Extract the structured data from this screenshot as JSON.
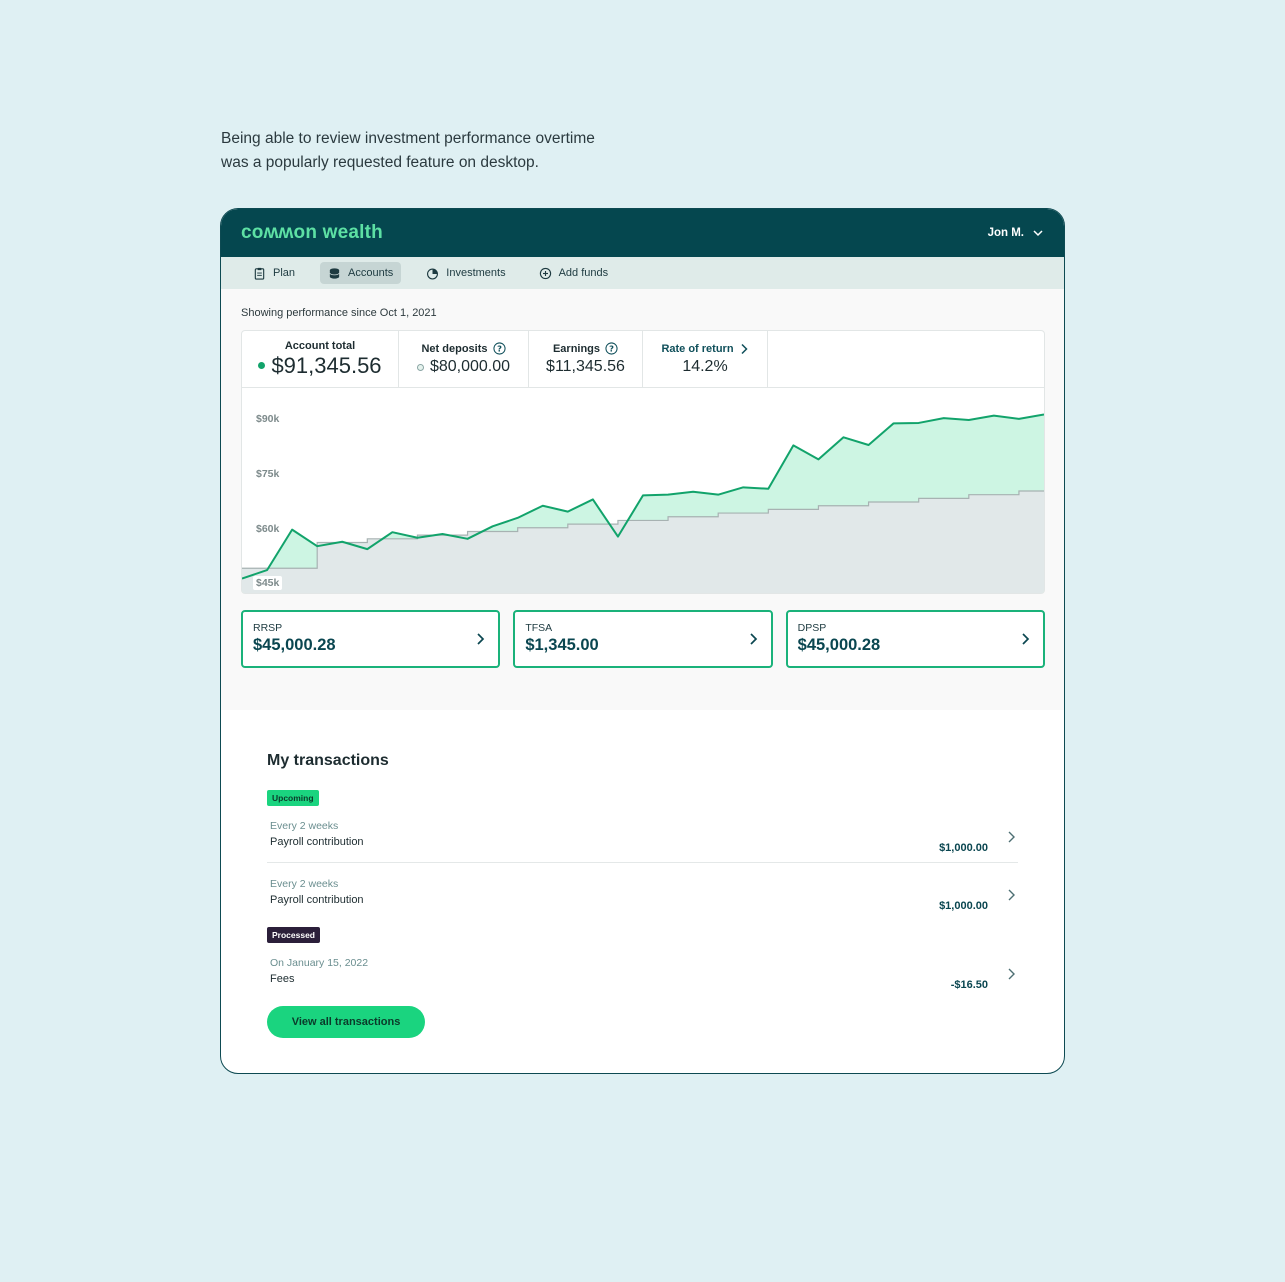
{
  "caption": {
    "line1": "Being able to review investment performance overtime",
    "line2": "was a popularly requested feature on desktop."
  },
  "header": {
    "logo": "coʍʍon wealth",
    "user": "Jon M."
  },
  "nav": [
    {
      "label": "Plan",
      "icon": "clipboard-icon",
      "active": false
    },
    {
      "label": "Accounts",
      "icon": "coins-icon",
      "active": true
    },
    {
      "label": "Investments",
      "icon": "pie-chart-icon",
      "active": false
    },
    {
      "label": "Add funds",
      "icon": "plus-circle-icon",
      "active": false
    }
  ],
  "performance": {
    "since": "Showing performance since Oct 1, 2021",
    "account_total_label": "Account total",
    "account_total": "$91,345.56",
    "net_deposits_label": "Net deposits",
    "net_deposits": "$80,000.00",
    "earnings_label": "Earnings",
    "earnings": "$11,345.56",
    "rate_label": "Rate of return",
    "rate": "14.2%"
  },
  "chart_data": {
    "type": "area",
    "y_ticks": [
      "$90k",
      "$75k",
      "$60k",
      "$45k"
    ],
    "ylim": [
      40000,
      96000
    ],
    "colors": {
      "total": "#12a36b",
      "total_fill": "#cdf5e3",
      "deposits": "#a7b2b2",
      "deposits_fill": "#e1e8e9"
    },
    "series": [
      {
        "name": "Account total",
        "values": [
          44200,
          46500,
          57500,
          53000,
          54200,
          52200,
          56800,
          55300,
          56300,
          55000,
          58400,
          60700,
          64000,
          62400,
          65700,
          55600,
          66800,
          67000,
          67800,
          67000,
          69000,
          68600,
          80400,
          76600,
          82600,
          80500,
          86400,
          86500,
          87800,
          87300,
          88500,
          87600,
          88800
        ]
      },
      {
        "name": "Net deposits",
        "values": [
          47000,
          47000,
          47000,
          54000,
          54000,
          55000,
          55000,
          56000,
          56000,
          57000,
          57000,
          58000,
          58000,
          59000,
          59000,
          60000,
          60000,
          61000,
          61000,
          62000,
          62000,
          63000,
          63000,
          64000,
          64000,
          65000,
          65000,
          66000,
          66000,
          67000,
          67000,
          68000,
          68000
        ]
      }
    ]
  },
  "accounts": [
    {
      "name": "RRSP",
      "value": "$45,000.28"
    },
    {
      "name": "TFSA",
      "value": "$1,345.00"
    },
    {
      "name": "DPSP",
      "value": "$45,000.28"
    }
  ],
  "transactions": {
    "title": "My transactions",
    "upcoming_badge": "Upcoming",
    "processed_badge": "Processed",
    "items": [
      {
        "freq": "Every 2 weeks",
        "desc": "Payroll contribution",
        "amount": "$1,000.00"
      },
      {
        "freq": "Every 2 weeks",
        "desc": "Payroll contribution",
        "amount": "$1,000.00"
      },
      {
        "freq": "On January 15, 2022",
        "desc": "Fees",
        "amount": "-$16.50"
      }
    ],
    "view_all": "View all transactions"
  }
}
